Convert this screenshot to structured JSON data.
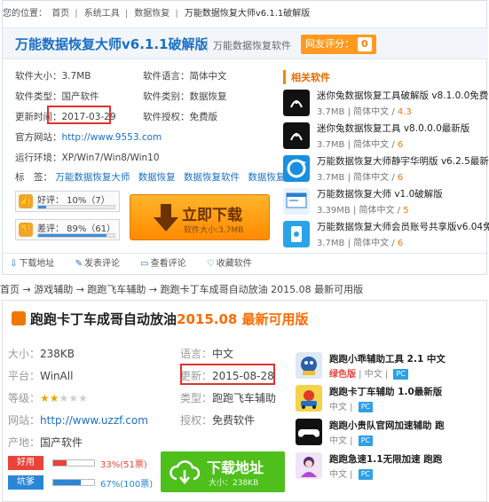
{
  "top": {
    "breadcrumb": [
      "您的位置：",
      "首页",
      "系统工具",
      "数据恢复",
      "万能数据恢复大师v6.1.1破解版"
    ],
    "title": "万能数据恢复大师v6.1.1破解版",
    "subtitle": "万能数据恢复软件",
    "score_label": "网友评分：",
    "score_value": "0",
    "info": {
      "size_label": "软件大小：",
      "size": "3.7MB",
      "lang_label": "软件语言：",
      "lang": "简体中文",
      "type_label": "软件类型：",
      "type": "国产软件",
      "category_label": "软件类别：",
      "category": "数据恢复",
      "updated_label": "更新时间：",
      "updated": "2017-03-29",
      "license_label": "软件授权：",
      "license": "免费版",
      "site_label": "官方网站：",
      "site": "http://www.9553.com",
      "env_label": "运行环境：",
      "env": "XP/Win7/Win8/Win10",
      "tags_label": "标　签：",
      "tags": [
        "万能数据恢复大师",
        "数据恢复",
        "数据恢复软件",
        "数据恢复大"
      ]
    },
    "good_vote": "好评：  10%（7）",
    "good_pct": 10,
    "bad_vote": "差评：  89%（61）",
    "bad_pct": 89,
    "download_label": "立即下载",
    "download_size": "软件大小:3.7MB",
    "actions": [
      "下载地址",
      "发表评论",
      "查看评论",
      "收藏软件"
    ],
    "related_title": "相关软件",
    "related": [
      {
        "name": "迷你兔数据恢复工具破解版 v8.1.0.0免费",
        "size": "3.7MB",
        "lang": "简体中文",
        "score": "4.3"
      },
      {
        "name": "迷你兔数据恢复工具 v8.0.0.0最新版",
        "size": "3.7MB",
        "lang": "简体中文",
        "score": "6"
      },
      {
        "name": "万能数据恢复大师静宇华明版 v6.2.5最新",
        "size": "3.7MB",
        "lang": "简体中文",
        "score": "6"
      },
      {
        "name": "万能数据恢复大师 v1.0破解版",
        "size": "3.39MB",
        "lang": "简体中文",
        "score": "5"
      },
      {
        "name": "万能数据恢复大师会员账号共享版v6.04免",
        "size": "3.7MB",
        "lang": "简体中文",
        "score": "6"
      }
    ]
  },
  "bottom": {
    "breadcrumb": "首页 → 游戏辅助 → 跑跑飞车辅助 → 跑跑卡丁车成哥自动放油 2015.08 最新可用版",
    "title": "跑跑卡丁车成哥自动放油",
    "title_year": "2015.08 最新可用版",
    "size_label": "大小：",
    "size": "238KB",
    "lang_label": "语言：",
    "lang": "中文",
    "platform_label": "平台：",
    "platform": "WinAll",
    "updated_label": "更新：",
    "updated": "2015-08-28",
    "rating_label": "等级：",
    "rating": 2,
    "rating_max": 5,
    "category_label": "类型：",
    "category": "跑跑飞车辅助",
    "site_label": "网站：",
    "site": "http://www.uzzf.com",
    "license_label": "授权：",
    "license": "免费软件",
    "origin_label": "产地：",
    "origin": "国产软件",
    "good_badge": "好用",
    "good_pct_text": "33%(51票)",
    "good_pct": 33,
    "bad_badge": "坑爹",
    "bad_pct_text": "67%(100票)",
    "bad_pct": 67,
    "download_label": "下载地址",
    "download_size": "大小：238KB",
    "related": [
      {
        "name": "跑跑小乖辅助工具 2.1 中文",
        "lang": "绿色版",
        "lang2": "中文",
        "pc": "PC"
      },
      {
        "name": "跑跑卡丁车辅助 1.0最新版",
        "lang": "中文",
        "pc": "PC"
      },
      {
        "name": "跑跑小贵队官网加速辅助 跑",
        "lang": "中文",
        "pc": "PC"
      },
      {
        "name": "跑跑急速1.1无限加速 跑跑",
        "lang": "中文",
        "pc": "PC"
      }
    ]
  },
  "colors": {
    "accent": "#1b6fc4",
    "orange": "#ff8a00",
    "green": "#4fbf1c",
    "highlight_box": "#e0322d"
  }
}
